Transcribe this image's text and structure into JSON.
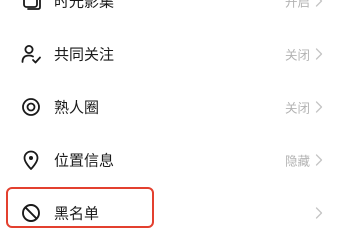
{
  "settings_list": {
    "items": [
      {
        "label": "时光影集",
        "value": "开启",
        "icon": "album-icon"
      },
      {
        "label": "共同关注",
        "value": "关闭",
        "icon": "person-check-icon"
      },
      {
        "label": "熟人圈",
        "value": "关闭",
        "icon": "circle-dot-icon"
      },
      {
        "label": "位置信息",
        "value": "隐藏",
        "icon": "location-pin-icon"
      },
      {
        "label": "黑名单",
        "value": "",
        "icon": "block-icon"
      }
    ]
  },
  "colors": {
    "highlight": "#e3402f",
    "label_text": "#1a1a1a",
    "value_text": "#b3b3b3"
  }
}
